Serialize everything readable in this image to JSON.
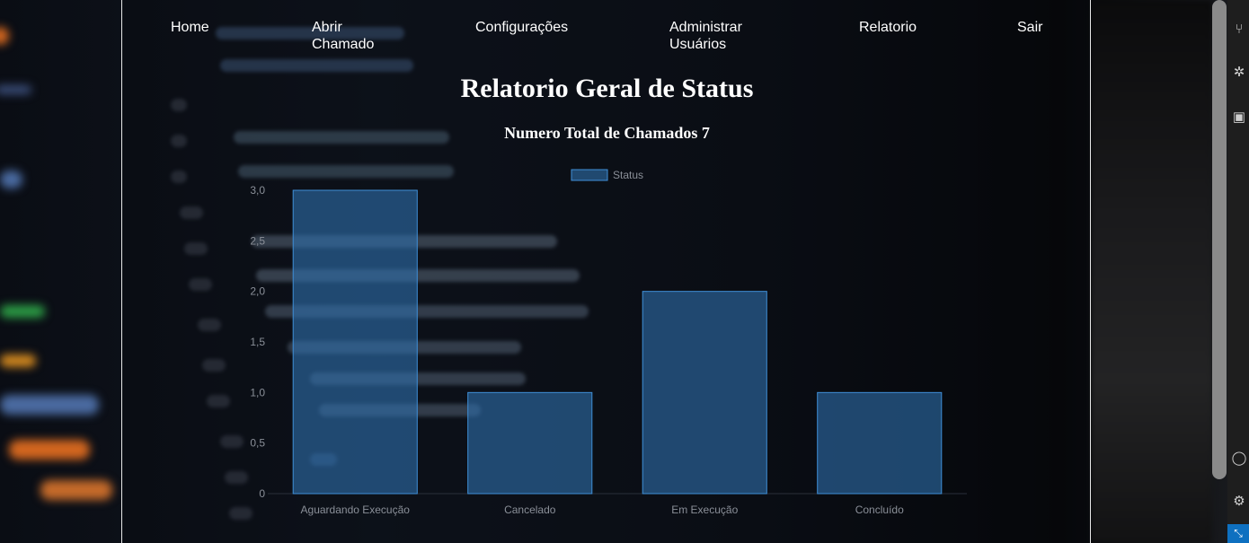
{
  "nav": {
    "items": [
      "Home",
      "Abrir Chamado",
      "Configurações",
      "Administrar Usuários",
      "Relatorio",
      "Sair"
    ]
  },
  "page": {
    "title": "Relatorio Geral de Status",
    "subtitle": "Numero Total de Chamados 7"
  },
  "colors": {
    "bar_fill": "#2f6fae",
    "bar_stroke": "#3f8fd8",
    "tick_text": "#8a8f98",
    "legend_text": "#8a8f98"
  },
  "chart_data": {
    "type": "bar",
    "categories": [
      "Aguardando Execução",
      "Cancelado",
      "Em Execução",
      "Concluído"
    ],
    "series": [
      {
        "name": "Status",
        "values": [
          3,
          1,
          2,
          1
        ]
      }
    ],
    "yticks": [
      "0",
      "0,5",
      "1,0",
      "1,5",
      "2,0",
      "2,5",
      "3,0"
    ],
    "ylim": [
      0,
      3
    ],
    "legend": "top-center",
    "grid": false
  },
  "icons": [
    "source-control-icon",
    "debug-icon",
    "extensions-icon",
    "account-icon",
    "settings-gear-icon",
    "remote-icon"
  ]
}
